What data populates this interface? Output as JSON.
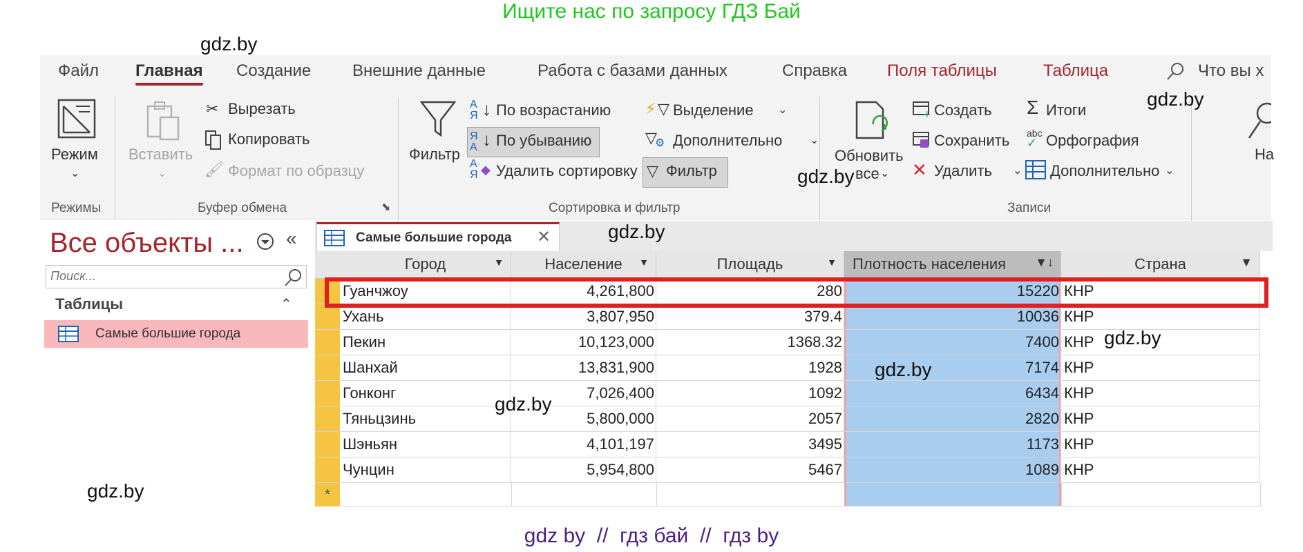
{
  "banner": "Ищите нас по запросу ГДЗ Бай",
  "footer": "gdz by  //  гдз бай  //  гдз by",
  "watermark": "gdz.by",
  "tabs": [
    "Файл",
    "Главная",
    "Создание",
    "Внешние данные",
    "Работа с базами данных",
    "Справка",
    "Поля таблицы",
    "Таблица"
  ],
  "tell_me": "Что вы х",
  "ribbon": {
    "mode": "Режим",
    "modes_group": "Режимы",
    "paste": "Вставить",
    "cut": "Вырезать",
    "copy": "Копировать",
    "format_painter": "Формат по образцу",
    "clipboard_group": "Буфер обмена",
    "filter": "Фильтр",
    "sort_asc": "По возрастанию",
    "sort_desc": "По убыванию",
    "remove_sort": "Удалить сортировку",
    "selection": "Выделение",
    "advanced": "Дополнительно",
    "toggle_filter": "Фильтр",
    "sort_filter_group": "Сортировка и фильтр",
    "refresh": "Обновить",
    "refresh_all": "все",
    "new": "Создать",
    "save": "Сохранить",
    "delete": "Удалить",
    "totals": "Итоги",
    "spelling": "Орфография",
    "more": "Дополнительно",
    "records_group": "Записи",
    "find_partial": "На"
  },
  "nav": {
    "title": "Все объекты ...",
    "search_placeholder": "Поиск...",
    "group": "Таблицы",
    "item": "Самые большие города"
  },
  "doc_tab": "Самые большие города",
  "table": {
    "columns": [
      "Город",
      "Население",
      "Площадь",
      "Плотность населения",
      "Страна"
    ],
    "rows": [
      [
        "Гуанчжоу",
        "4,261,800",
        "280",
        "15220",
        "КНР"
      ],
      [
        "Ухань",
        "3,807,950",
        "379.4",
        "10036",
        "КНР"
      ],
      [
        "Пекин",
        "10,123,000",
        "1368.32",
        "7400",
        "КНР"
      ],
      [
        "Шанхай",
        "13,831,900",
        "1928",
        "7174",
        "КНР"
      ],
      [
        "Гонконг",
        "7,026,400",
        "1092",
        "6434",
        "КНР"
      ],
      [
        "Тяньцзинь",
        "5,800,000",
        "2057",
        "2820",
        "КНР"
      ],
      [
        "Шэньян",
        "4,101,197",
        "3495",
        "1173",
        "КНР"
      ],
      [
        "Чунцин",
        "5,954,800",
        "5467",
        "1089",
        "КНР"
      ]
    ],
    "new_row_marker": "*"
  },
  "colors": {
    "accent": "#a4262c",
    "highlight": "#e02020",
    "selected_column": "#a8cdee",
    "nav_selected": "#f8b8bc",
    "row_selector": "#f5c542"
  }
}
